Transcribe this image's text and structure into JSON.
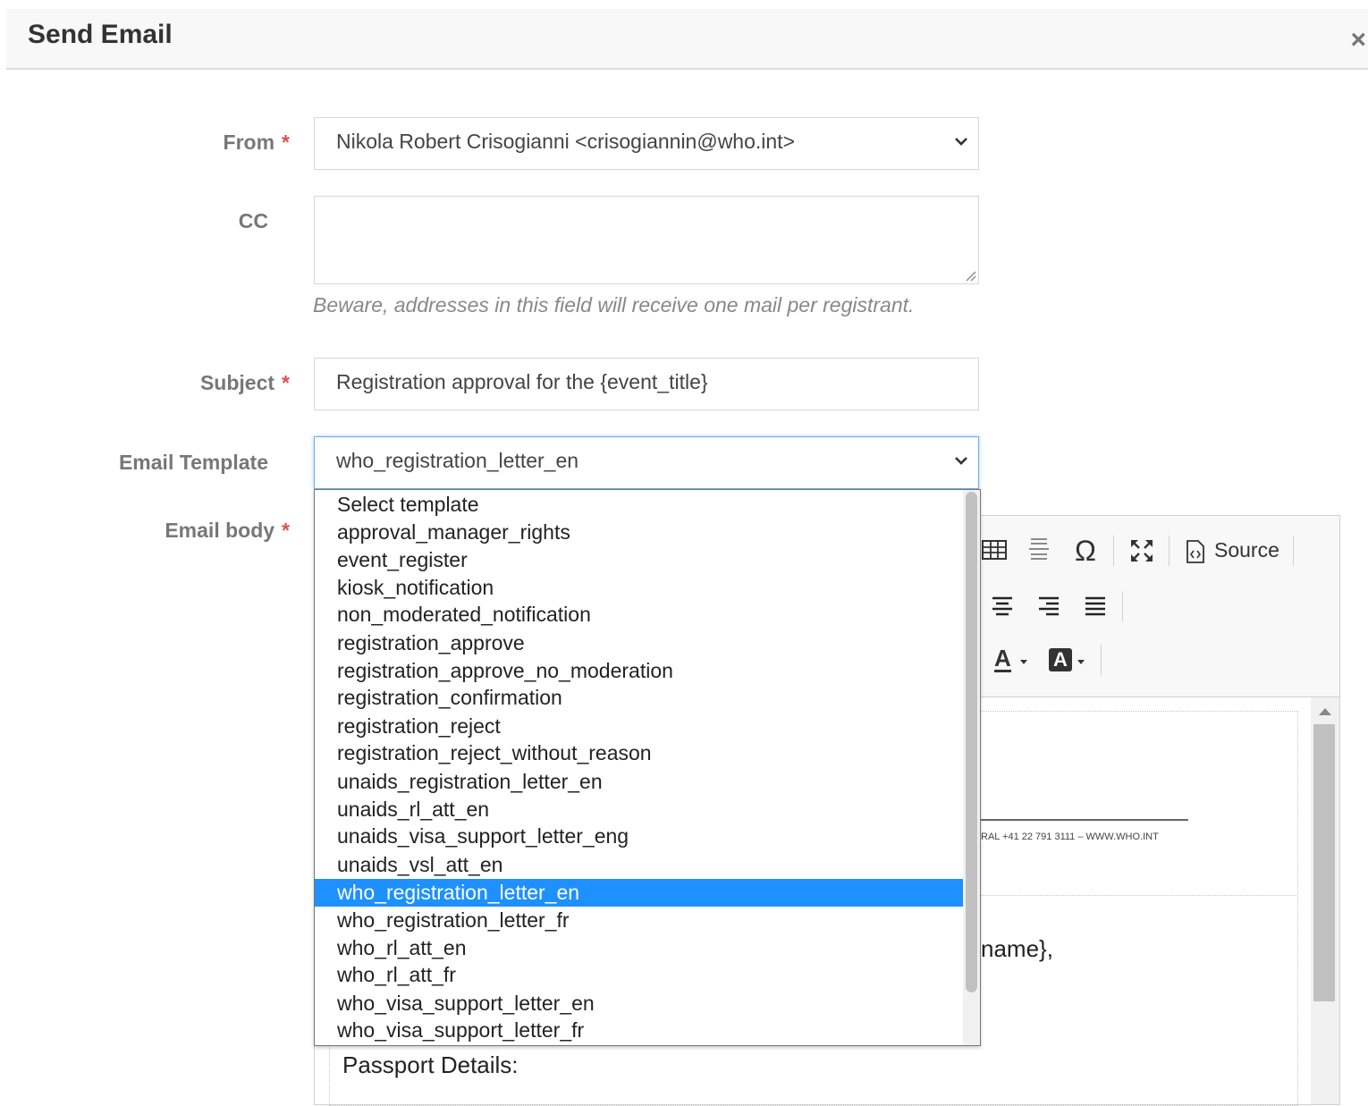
{
  "modal": {
    "title": "Send Email",
    "close_icon": "×"
  },
  "form": {
    "from": {
      "label": "From",
      "value": "Nikola Robert Crisogianni <crisogiannin@who.int>"
    },
    "cc": {
      "label": "CC",
      "value": "",
      "help": "Beware, addresses in this field will receive one mail per registrant."
    },
    "subject": {
      "label": "Subject",
      "value": "Registration approval for the {event_title}"
    },
    "template": {
      "label": "Email Template",
      "value": "who_registration_letter_en"
    },
    "body": {
      "label": "Email body"
    },
    "required_marker": "*"
  },
  "editor": {
    "source_label": "Source",
    "omega": "Ω",
    "text_color": "A",
    "bg_color": "A",
    "footer_line": "RAL +41 22 791 3111 – WWW.WHO.INT",
    "greeting_fragment": "name},",
    "passport_label": "Passport Details:"
  },
  "dropdown": {
    "options": [
      "Select template",
      "approval_manager_rights",
      "event_register",
      "kiosk_notification",
      "non_moderated_notification",
      "registration_approve",
      "registration_approve_no_moderation",
      "registration_confirmation",
      "registration_reject",
      "registration_reject_without_reason",
      "unaids_registration_letter_en",
      "unaids_rl_att_en",
      "unaids_visa_support_letter_eng",
      "unaids_vsl_att_en",
      "who_registration_letter_en",
      "who_registration_letter_fr",
      "who_rl_att_en",
      "who_rl_att_fr",
      "who_visa_support_letter_en",
      "who_visa_support_letter_fr"
    ],
    "selected": "who_registration_letter_en"
  },
  "colors": {
    "required": "#d9534f",
    "selected_option": "#1e90ff",
    "focus_border": "#66afe9"
  }
}
